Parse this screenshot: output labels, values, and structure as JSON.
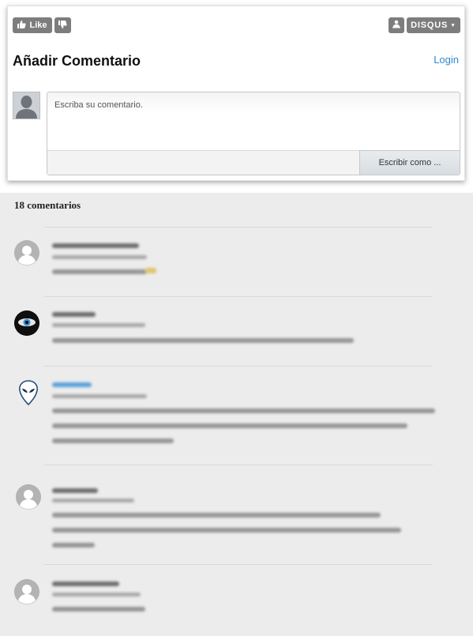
{
  "widget": {
    "like_label": "Like",
    "disqus_label": "DISQUS",
    "title": "Añadir Comentario",
    "login_label": "Login",
    "comment_placeholder": "Escriba su comentario.",
    "post_as_label": "Escribir como ..."
  },
  "comments": {
    "count_label": "18 comentarios"
  },
  "icons": {
    "like": "thumbs-up-icon",
    "dislike": "thumbs-down-icon",
    "community": "community-icon",
    "disqus_menu": "chevron-down-icon",
    "user": "user-silhouette-icon"
  },
  "colors": {
    "button_gray": "#7d7d7d",
    "link_blue": "#2e8bcf",
    "list_background": "#ececec"
  }
}
